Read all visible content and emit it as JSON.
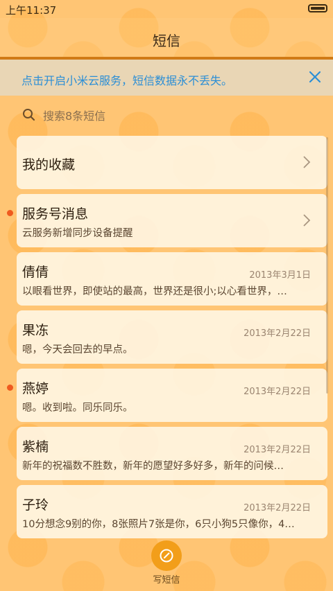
{
  "status": {
    "time": "上午11:37"
  },
  "title": "短信",
  "banner": {
    "text": "点击开启小米云服务，短信数据永不丢失。"
  },
  "search": {
    "placeholder": "搜索8条短信"
  },
  "items": [
    {
      "name": "我的收藏",
      "snippet": "",
      "date": "",
      "unread": false,
      "chevron": true
    },
    {
      "name": "服务号消息",
      "snippet": "云服务新增同步设备提醒",
      "date": "",
      "unread": true,
      "chevron": true
    },
    {
      "name": "倩倩",
      "snippet": "以眼看世界，即使站的最高，世界还是很小;以心看世界，…",
      "date": "2013年3月1日",
      "unread": false,
      "chevron": false
    },
    {
      "name": "果冻",
      "snippet": "嗯，今天会回去的早点。",
      "date": "2013年2月22日",
      "unread": false,
      "chevron": false
    },
    {
      "name": "燕婷",
      "snippet": "嗯。收到啦。同乐同乐。",
      "date": "2013年2月22日",
      "unread": true,
      "chevron": false
    },
    {
      "name": "紫楠",
      "snippet": "新年的祝福数不胜数，新年的愿望好多好多，新年的问候…",
      "date": "2013年2月22日",
      "unread": false,
      "chevron": false
    },
    {
      "name": "子玲",
      "snippet": "10分想念9别的你，8张照片7张是你，6只小狗5只像你，4…",
      "date": "2013年2月22日",
      "unread": false,
      "chevron": false
    }
  ],
  "compose": {
    "label": "写短信"
  },
  "colors": {
    "accent": "#f29e1a",
    "link": "#2a8ed6",
    "unread_dot": "#ef5a1f",
    "title_rule": "#d07a16"
  },
  "icons": {
    "search": "search-icon",
    "close": "close-icon",
    "chevron": "chevron-right-icon",
    "compose": "compose-icon",
    "battery": "battery-icon"
  }
}
